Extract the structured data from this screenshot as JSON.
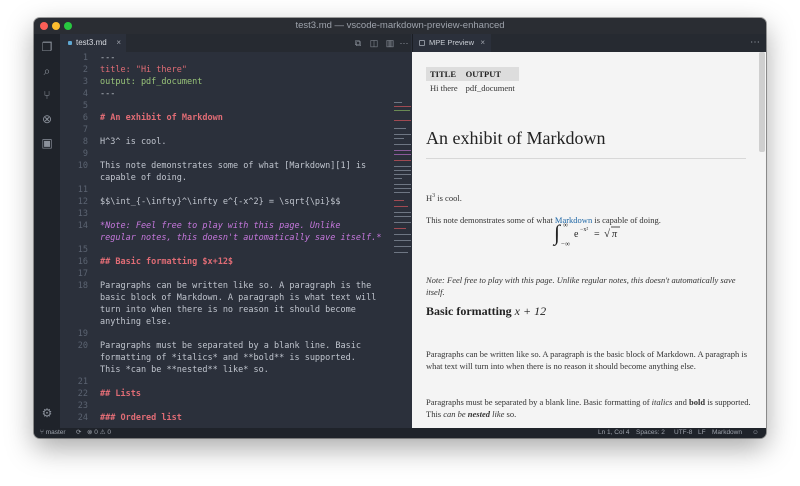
{
  "window": {
    "title": "test3.md — vscode-markdown-preview-enhanced"
  },
  "editor": {
    "tab_label": "test3.md",
    "lines": [
      {
        "n": "1",
        "text": "---"
      },
      {
        "n": "2",
        "text": "title: \"Hi there\""
      },
      {
        "n": "3",
        "text": "output: pdf_document"
      },
      {
        "n": "4",
        "text": "---"
      },
      {
        "n": "5",
        "text": ""
      },
      {
        "n": "6",
        "text": "# An exhibit of Markdown"
      },
      {
        "n": "7",
        "text": ""
      },
      {
        "n": "8",
        "text": "H^3^ is cool."
      },
      {
        "n": "9",
        "text": ""
      },
      {
        "n": "10",
        "text": "This note demonstrates some of what [Markdown][1] is"
      },
      {
        "n": "",
        "text": "capable of doing."
      },
      {
        "n": "11",
        "text": ""
      },
      {
        "n": "12",
        "text": "$$\\int_{-\\infty}^\\infty e^{-x^2} = \\sqrt{\\pi}$$"
      },
      {
        "n": "13",
        "text": ""
      },
      {
        "n": "14",
        "text": "*Note: Feel free to play with this page. Unlike"
      },
      {
        "n": "",
        "text": "regular notes, this doesn't automatically save itself.*"
      },
      {
        "n": "15",
        "text": ""
      },
      {
        "n": "16",
        "text": "## Basic formatting $x+12$"
      },
      {
        "n": "17",
        "text": ""
      },
      {
        "n": "18",
        "text": "Paragraphs can be written like so. A paragraph is the"
      },
      {
        "n": "",
        "text": "basic block of Markdown. A paragraph is what text will"
      },
      {
        "n": "",
        "text": "turn into when there is no reason it should become"
      },
      {
        "n": "",
        "text": "anything else."
      },
      {
        "n": "19",
        "text": ""
      },
      {
        "n": "20",
        "text": "Paragraphs must be separated by a blank line. Basic"
      },
      {
        "n": "",
        "text": "formatting of *italics* and **bold** is supported."
      },
      {
        "n": "",
        "text": "This *can be **nested** like* so."
      },
      {
        "n": "21",
        "text": ""
      },
      {
        "n": "22",
        "text": "## Lists"
      },
      {
        "n": "23",
        "text": ""
      },
      {
        "n": "24",
        "text": "### Ordered list"
      }
    ]
  },
  "preview": {
    "tab_label": "MPE Preview",
    "table": {
      "headers": [
        "TITLE",
        "OUTPUT"
      ],
      "rows": [
        [
          "Hi there",
          "pdf_document"
        ]
      ]
    },
    "h1": "An exhibit of Markdown",
    "p1_pre": "H",
    "p1_sup": "3",
    "p1_post": " is cool.",
    "p2_pre": "This note demonstrates some of what ",
    "p2_link": "Markdown",
    "p2_post": " is capable of doing.",
    "equation": "∫₋∞^∞ e^(−x²) = √π",
    "note": "Note: Feel free to play with this page. Unlike regular notes, this doesn't automatically save itself.",
    "h2_pre": "Basic formatting ",
    "h2_math": "x + 12",
    "p3": "Paragraphs can be written like so. A paragraph is the basic block of Markdown. A paragraph is what text will turn into when there is no reason it should become anything else.",
    "p4_a": "Paragraphs must be separated by a blank line. Basic formatting of ",
    "p4_i": "italics",
    "p4_b_pre": " and ",
    "p4_b": "bold",
    "p4_c": " is supported. This ",
    "p4_d": "can be ",
    "p4_e": "nested",
    "p4_f": " like",
    "p4_g": " so."
  },
  "status": {
    "branch": "master",
    "errors": "0",
    "warnings": "0",
    "position": "Ln 1, Col 4",
    "spaces": "Spaces: 2",
    "encoding": "UTF-8",
    "eol": "LF",
    "language": "Markdown"
  }
}
